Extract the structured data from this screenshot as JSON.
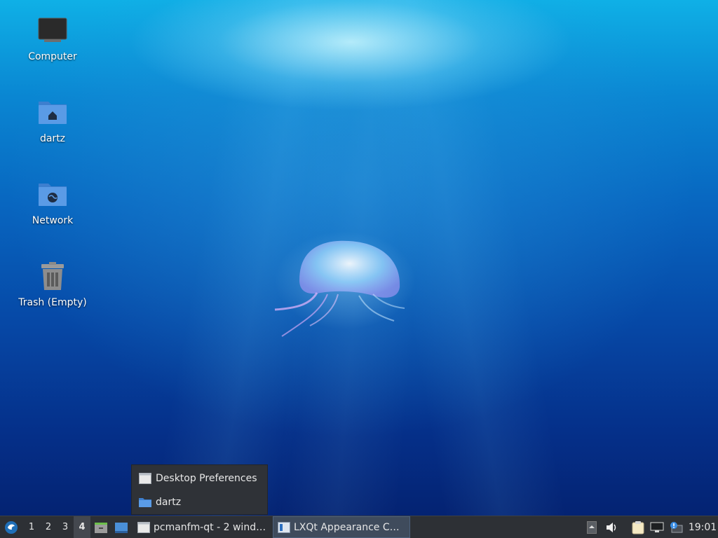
{
  "desktop": {
    "icons": [
      {
        "label": "Computer",
        "icon": "computer-icon"
      },
      {
        "label": "dartz",
        "icon": "home-folder-icon"
      },
      {
        "label": "Network",
        "icon": "network-folder-icon"
      },
      {
        "label": "Trash (Empty)",
        "icon": "trash-icon"
      }
    ]
  },
  "popup_menu": {
    "items": [
      {
        "label": "Desktop Preferences",
        "icon": "window-icon"
      },
      {
        "label": "dartz",
        "icon": "folder-icon"
      }
    ]
  },
  "taskbar": {
    "menu_icon": "lxqt-menu-icon",
    "desktops": [
      "1",
      "2",
      "3",
      "4"
    ],
    "active_desktop": "4",
    "quicklaunch": [
      "file-manager-icon",
      "show-desktop-icon"
    ],
    "tasks": [
      {
        "label": "pcmanfm-qt - 2 windo…",
        "icon": "window-icon"
      },
      {
        "label": "LXQt Appearance Con…",
        "icon": "appearance-icon",
        "active": true
      }
    ],
    "tray": [
      "tray-arrow-icon",
      "volume-icon",
      "clipboard-icon",
      "network-monitor-icon",
      "update-notifier-icon"
    ],
    "clock": "19:01"
  },
  "colors": {
    "panel": "#2d3035",
    "popup": "#2f3237",
    "active_task": "#3f4b5c",
    "folder_blue": "#4a8fd8"
  }
}
